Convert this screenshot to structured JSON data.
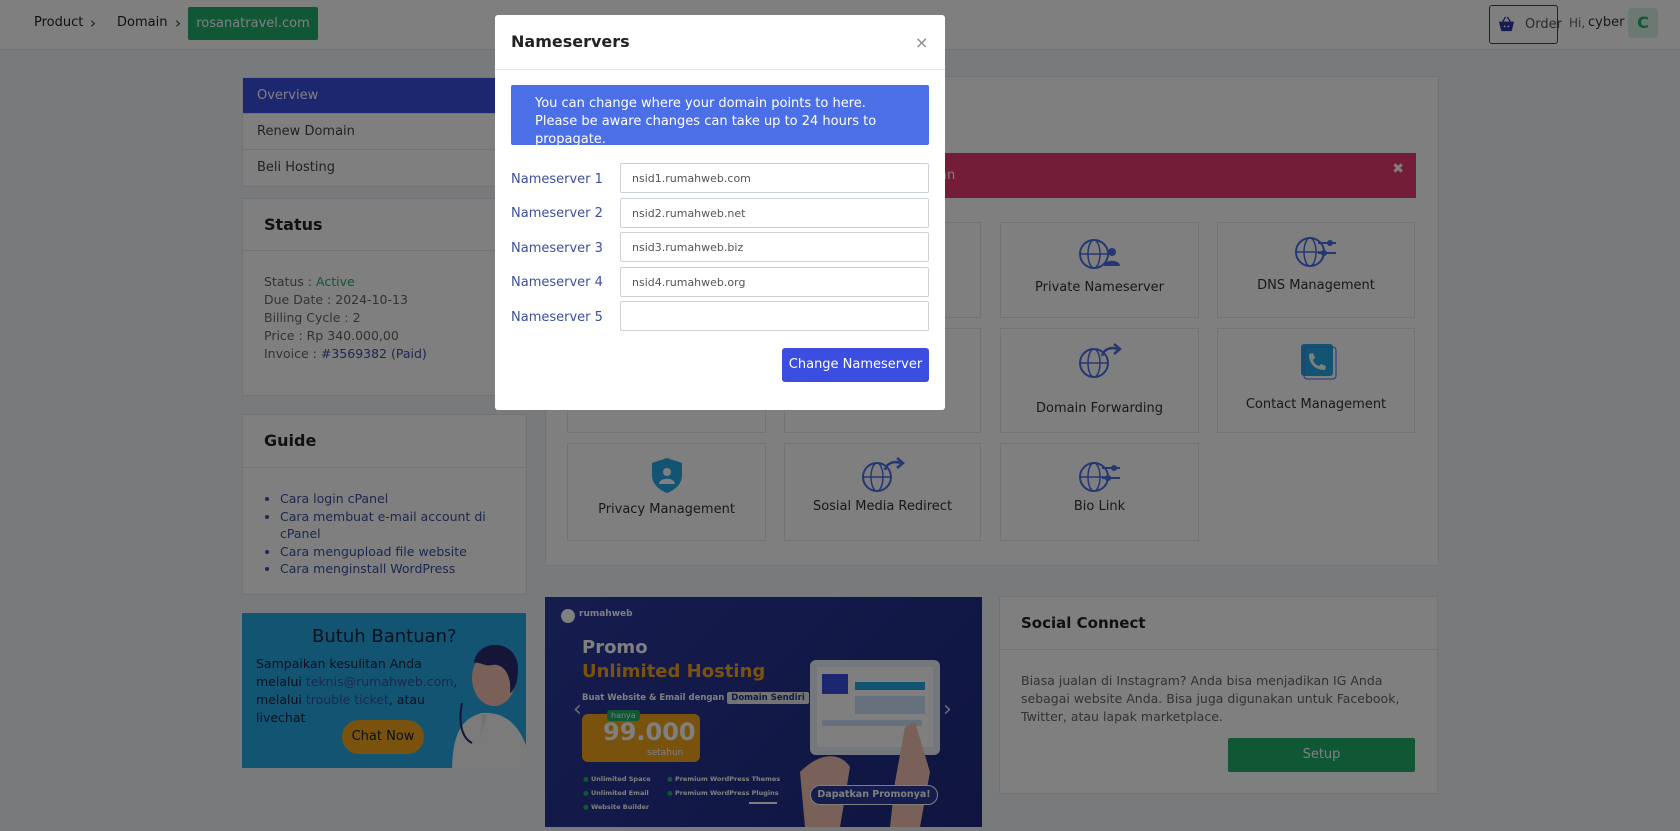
{
  "breadcrumb": {
    "product": "Product",
    "domain": "Domain",
    "active": "rosanatravel.com"
  },
  "header": {
    "order": "Order",
    "hi": "Hi,",
    "user": "cyber",
    "avatar_letter": "C"
  },
  "sidebar": {
    "items": [
      "Overview",
      "Renew Domain",
      "Beli Hosting"
    ]
  },
  "status": {
    "title": "Status",
    "status_label": "Status : ",
    "status_value": "Active",
    "due_date": "Due Date : 2024-10-13",
    "billing_cycle": "Billing Cycle : 2",
    "price": "Price : Rp 340.000,00",
    "invoice_label": "Invoice : ",
    "invoice_value": "#3569382 (Paid)"
  },
  "guide": {
    "title": "Guide",
    "items": [
      "Cara login cPanel",
      "Cara membuat e-mail account di cPanel",
      "Cara mengupload file website",
      "Cara menginstall WordPress"
    ]
  },
  "help": {
    "title": "Butuh Bantuan?",
    "text1": "Sampaikan kesulitan Anda melalui ",
    "email": "teknis@rumahweb.com",
    "text2": ", melalui ",
    "trouble": "trouble ticket",
    "text3": ", atau livechat",
    "button": "Chat Now"
  },
  "alert": {
    "text": "an"
  },
  "tiles": [
    "Private Nameserver",
    "DNS Management",
    "Domain Forwarding",
    "Contact Management",
    "Privacy Management",
    "Sosial Media Redirect",
    "Bio Link"
  ],
  "banner": {
    "brand": "rumahweb",
    "promo": "Promo",
    "headline": "Unlimited Hosting",
    "sub": "Buat Website & Email dengan",
    "sub_tag": "Domain Sendiri",
    "hanya": "hanya",
    "price": "99.000",
    "per": "setahun",
    "features": [
      "Unlimited Space",
      "Premium WordPress Themes",
      "Unlimited Email",
      "Premium WordPress Plugins",
      "Website Builder"
    ],
    "cta": "Dapatkan Promonya!"
  },
  "social": {
    "title": "Social Connect",
    "text": "Biasa jualan di Instagram? Anda bisa menjadikan IG Anda sebagai website Anda. Bisa juga digunakan untuk Facebook, Twitter, atau lapak marketplace.",
    "button": "Setup"
  },
  "modal": {
    "title": "Nameservers",
    "close": "×",
    "info": "You can change where your domain points to here. Please be aware changes can take up to 24 hours to propagate.",
    "labels": [
      "Nameserver 1",
      "Nameserver 2",
      "Nameserver 3",
      "Nameserver 4",
      "Nameserver 5"
    ],
    "values": [
      "nsid1.rumahweb.com",
      "nsid2.rumahweb.net",
      "nsid3.rumahweb.biz",
      "nsid4.rumahweb.org",
      ""
    ],
    "button": "Change Nameserver"
  },
  "colors": {
    "primary": "#3b4ee0",
    "green": "#1fae6a",
    "danger": "#e63a73",
    "info": "#4a6fe6",
    "help": "#27a9e6"
  }
}
